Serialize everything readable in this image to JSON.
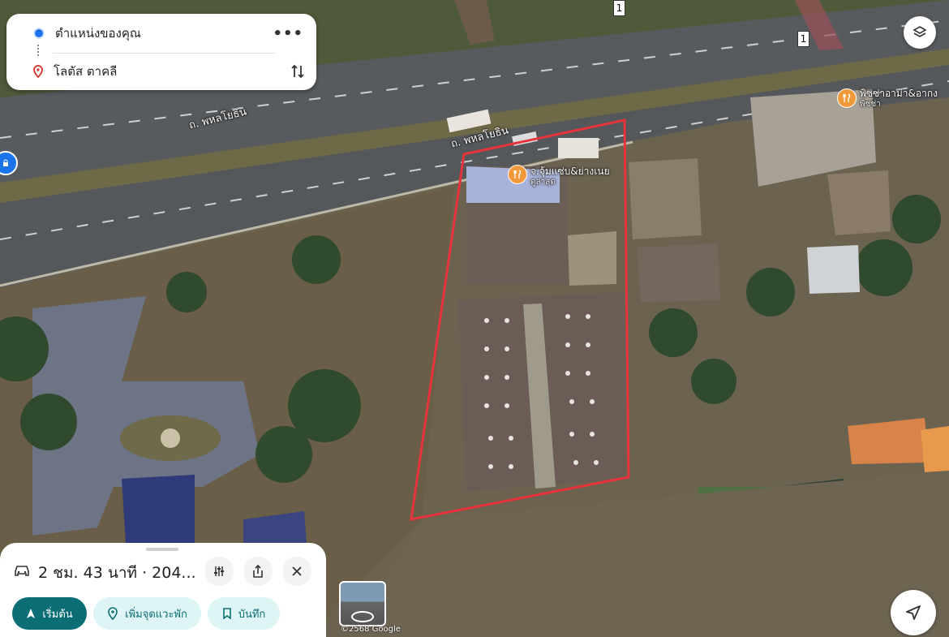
{
  "route": {
    "origin": "ตำแหน่งของคุณ",
    "destination": "โลตัส ตาคลี"
  },
  "map": {
    "road_labels": [
      "ถ. พหลโยธิน",
      "ถ. พหลโยธิน"
    ],
    "highway_shield": "1",
    "pois": [
      {
        "name": "จ.จุ้มแซ่บ&ย่างเนย",
        "category": "ดูล่าสุด"
      },
      {
        "name": "พิซซ่าอาม่า&อากง",
        "category": "พิซซ่า"
      }
    ],
    "copyright": "©2568 Google",
    "colors": {
      "boundary": "#e8323c",
      "poi_marker": "#f29a3a",
      "route_blue": "#1a73e8"
    }
  },
  "bottom_sheet": {
    "summary": "2 ชม. 43 นาที · 204...",
    "buttons": {
      "start": "เริ่มต้น",
      "add_stop": "เพิ่มจุดแวะพัก",
      "save": "บันทึก"
    },
    "colors": {
      "start_bg": "#0b6e74",
      "secondary_bg": "#def4f5",
      "secondary_text": "#0b6e74"
    }
  },
  "icons": [
    "origin-dot-icon",
    "destination-pin-icon",
    "more-icon",
    "swap-icon",
    "layers-icon",
    "car-icon",
    "tune-icon",
    "share-icon",
    "close-icon",
    "navigate-icon",
    "add-stop-icon",
    "bookmark-icon",
    "locate-icon",
    "restaurant-icon"
  ]
}
